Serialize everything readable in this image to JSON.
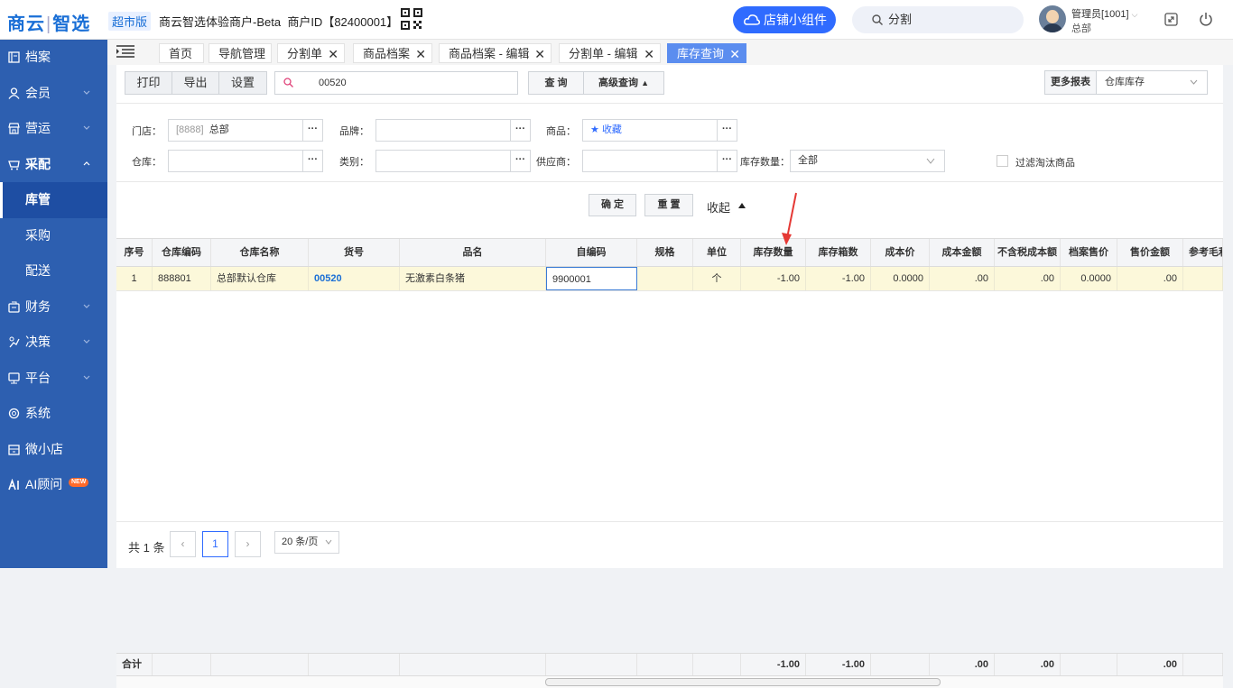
{
  "top": {
    "logo_left": "商云",
    "logo_right": "智选",
    "edition": "超市版",
    "merchant_name": "商云智选体验商户-Beta",
    "merchant_id": "商户ID【82400001】",
    "shop_widget": "店铺小组件",
    "search_value": "分割",
    "user_name": "管理员[1001]",
    "user_store": "总部"
  },
  "sidebar": {
    "items": [
      {
        "label": "档案",
        "icon": "archive-icon"
      },
      {
        "label": "会员",
        "icon": "member-icon"
      },
      {
        "label": "营运",
        "icon": "store-icon"
      },
      {
        "label": "采配",
        "icon": "purchase-icon"
      },
      {
        "label": "库管"
      },
      {
        "label": "采购"
      },
      {
        "label": "配送"
      },
      {
        "label": "财务",
        "icon": "finance-icon"
      },
      {
        "label": "决策",
        "icon": "decision-icon"
      },
      {
        "label": "平台",
        "icon": "platform-icon"
      },
      {
        "label": "系统",
        "icon": "system-icon"
      },
      {
        "label": "微小店",
        "icon": "shop-icon"
      },
      {
        "label": "AI顾问",
        "icon": "ai-icon",
        "badge": "NEW"
      }
    ]
  },
  "tabs": [
    {
      "label": "首页"
    },
    {
      "label": "导航管理"
    },
    {
      "label": "分割单"
    },
    {
      "label": "商品档案"
    },
    {
      "label": "商品档案 - 编辑"
    },
    {
      "label": "分割单 - 编辑"
    },
    {
      "label": "库存查询",
      "active": true
    }
  ],
  "toolbar": {
    "print": "打印",
    "export": "导出",
    "settings": "设置",
    "search_value": "00520",
    "query": "查 询",
    "advanced": "高级查询",
    "more_reports": "更多报表",
    "report_value": "仓库库存"
  },
  "filters": {
    "store_label": "门店：",
    "store_code": "[8888]",
    "store_name": "总部",
    "brand_label": "品牌：",
    "product_label": "商品：",
    "product_value": "收藏",
    "warehouse_label": "仓库：",
    "category_label": "类别：",
    "supplier_label": "供应商：",
    "stock_qty_label": "库存数量：",
    "stock_qty_value": "全部",
    "filter_discontinued": "过滤淘汰商品"
  },
  "actions": {
    "confirm": "确 定",
    "reset": "重 置",
    "collapse": "收起"
  },
  "table": {
    "headers": [
      "序号",
      "仓库编码",
      "仓库名称",
      "货号",
      "品名",
      "自编码",
      "规格",
      "单位",
      "库存数量",
      "库存箱数",
      "成本价",
      "成本金额",
      "不含税成本额",
      "档案售价",
      "售价金额",
      "参考毛利"
    ],
    "rows": [
      [
        "1",
        "888801",
        "总部默认仓库",
        "00520",
        "无激素白条猪",
        "9900001",
        "",
        "个",
        "-1.00",
        "-1.00",
        "0.0000",
        ".00",
        ".00",
        "0.0000",
        ".00",
        ""
      ]
    ],
    "footer_label": "合计",
    "footer": {
      "stock_qty": "-1.00",
      "stock_boxes": "-1.00",
      "cost_amount": ".00",
      "cost_ex_tax": ".00",
      "sale_amount": ".00"
    }
  },
  "pager": {
    "total": "共 1 条",
    "current_page": "1",
    "page_size": "20 条/页"
  },
  "colors": {
    "brand": "#1a6fd6",
    "sidebar": "#2d5fb0",
    "active_tab": "#5b8def",
    "row_highlight": "#fcf8da",
    "annotation_arrow": "#e53935"
  }
}
